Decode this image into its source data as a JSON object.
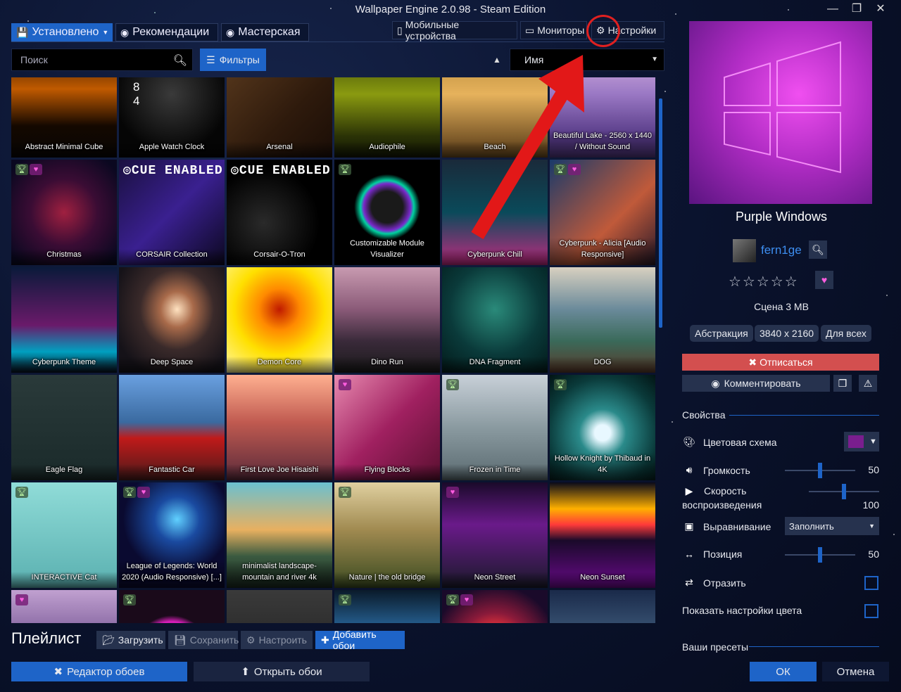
{
  "window": {
    "title": "Wallpaper Engine 2.0.98 - Steam Edition",
    "minimize": "—",
    "restore": "❐",
    "close": "✕"
  },
  "tabs": [
    {
      "label": "Установлено",
      "icon": "download-icon"
    },
    {
      "label": "Рекомендации",
      "icon": "steam-icon"
    },
    {
      "label": "Мастерская",
      "icon": "steam-icon"
    }
  ],
  "top_tabs": [
    {
      "label": "Мобильные устройства",
      "icon": "phone-icon"
    },
    {
      "label": "Мониторы",
      "icon": "monitor-icon"
    },
    {
      "label": "Настройки",
      "icon": "gear-icon"
    }
  ],
  "search": {
    "placeholder": "Поиск"
  },
  "filters": {
    "label": "Фильтры"
  },
  "sort": {
    "selected": "Имя"
  },
  "wallpapers": [
    {
      "title": "Abstract Minimal Cube",
      "bg": "linear-gradient(180deg,#3a1a00 0%,#c05a00 35%,#140800 70%,#080604 100%)",
      "badges": []
    },
    {
      "title": "Apple Watch Clock",
      "bg": "radial-gradient(circle at 50% 40%,#3a3a3a,#050505 70%)",
      "badges": [],
      "clock": true
    },
    {
      "title": "Arsenal",
      "bg": "linear-gradient(135deg,#5a3a1e,#2e1a0c 60%,#1a0d06)",
      "badges": []
    },
    {
      "title": "Audiophile",
      "bg": "linear-gradient(180deg,#3c4a08,#8a9a10 40%,#2a3206 80%,#121603)",
      "badges": []
    },
    {
      "title": "Beach",
      "bg": "linear-gradient(180deg,#b88a3a,#e6b25c 40%,#6a4a20 90%)",
      "badges": []
    },
    {
      "title": "Beautiful Lake - 2560 x 1440 / Without Sound",
      "bg": "linear-gradient(180deg,#d4b0e0,#9a78c4 40%,#563a86 80%)",
      "badges": []
    },
    {
      "title": "Christmas",
      "bg": "radial-gradient(circle at 50% 50%,#a02040 0%,#3a0c34 45%,#0a0820 90%)",
      "badges": [
        "trophy",
        "heart"
      ]
    },
    {
      "title": "CORSAIR Collection",
      "bg": "linear-gradient(135deg,#1a1040,#3a2090 50%,#0c0820)",
      "badges": [],
      "cue": true
    },
    {
      "title": "Corsair-O-Tron",
      "bg": "radial-gradient(circle at 35% 60%,#2a2a2a,#000 60%)",
      "badges": [],
      "cue": true
    },
    {
      "title": "Customizable Module Visualizer",
      "bg": "radial-gradient(circle at 50% 45%,#1a1a1a 20%,#7a2acc 30%,#00d2a0 34%,#000 42%)",
      "badges": [
        "trophy"
      ]
    },
    {
      "title": "Cyberpunk Chill",
      "bg": "linear-gradient(180deg,#1a2a3a,#0a4a5a 50%,#c02a80 100%)",
      "badges": []
    },
    {
      "title": "Cyberpunk - Alicia [Audio Responsive]",
      "bg": "linear-gradient(135deg,#1a3a6a,#c05a3a 60%,#2a1a2a)",
      "badges": [
        "trophy",
        "heart"
      ]
    },
    {
      "title": "Cyberpunk Theme",
      "bg": "linear-gradient(180deg,#0a1a3a,#6a1a6a 55%,#00a0c0 80%,#081020)",
      "badges": []
    },
    {
      "title": "Deep Space",
      "bg": "radial-gradient(ellipse at 55% 40%,#ffe2c0 0%,#a86a4a 20%,#3a2a2a 45%,#151218 80%)",
      "badges": []
    },
    {
      "title": "Demon Core",
      "bg": "radial-gradient(circle at 50% 40%,#c01a00 0%,#ff8a00 25%,#ffe000 55%,#fff6a0 100%)",
      "badges": []
    },
    {
      "title": "Dino Run",
      "bg": "linear-gradient(180deg,#c89ab0 0%,#8a5a78 40%,#3a2a3a 70%,#1a1a1a 100%)",
      "badges": []
    },
    {
      "title": "DNA Fragment",
      "bg": "radial-gradient(circle at 50% 40%,#2a8a7a,#0a3a3a 55%,#021a1a)",
      "badges": []
    },
    {
      "title": "DOG",
      "bg": "linear-gradient(180deg,#d8d0c0 0%,#6a8a9a 40%,#3a6a5a 70%,#5a3a2a 100%)",
      "badges": []
    },
    {
      "title": "Eagle Flag",
      "bg": "linear-gradient(180deg,#2a3a3a,#1a2a2a)",
      "badges": []
    },
    {
      "title": "Fantastic Car",
      "bg": "linear-gradient(180deg,#6aa0e0 0%,#3a6aa0 45%,#c01a1a 60%,#4a1a1a 100%)",
      "badges": []
    },
    {
      "title": "First Love Joe Hisaishi",
      "bg": "linear-gradient(180deg,#ffb090 0%,#c05a50 45%,#5a2a3a 100%)",
      "badges": []
    },
    {
      "title": "Flying Blocks",
      "bg": "linear-gradient(135deg,#e88ab0,#a02060 50%,#5a1030)",
      "badges": [
        "heart"
      ]
    },
    {
      "title": "Frozen in Time",
      "bg": "linear-gradient(180deg,#c8d0d8 0%,#8a9aa0 50%,#5a6a70 100%)",
      "badges": [
        "trophy"
      ]
    },
    {
      "title": "Hollow Knight by Thibaud in 4K",
      "bg": "radial-gradient(circle at 50% 55%,#e8f8ff 10%,#2a8a8a 30%,#0a3a3a 70%,#021414)",
      "badges": [
        "trophy"
      ]
    },
    {
      "title": "INTERACTIVE Cat",
      "bg": "linear-gradient(180deg,#90dcd8,#5ab0b0)",
      "badges": [
        "trophy"
      ]
    },
    {
      "title": "League of Legends: World 2020 (Audio Responsive) [...]",
      "bg": "radial-gradient(circle at 55% 35%,#60d0ff 0%,#1a4aa0 25%,#0a0a30 60%)",
      "badges": [
        "trophy",
        "heart"
      ]
    },
    {
      "title": "minimalist landscape-mountain and river 4k",
      "bg": "linear-gradient(180deg,#6ac0d0 0%,#e8b060 45%,#3a5a40 70%,#1a2a20 100%)",
      "badges": []
    },
    {
      "title": "Nature | the old bridge",
      "bg": "linear-gradient(180deg,#e0d0a0 0%,#a08a50 45%,#3a4a20 100%)",
      "badges": [
        "trophy"
      ]
    },
    {
      "title": "Neon Street",
      "bg": "linear-gradient(180deg,#1a0a2a,#6a1a8a 40%,#1a1a2a 100%)",
      "badges": [
        "heart"
      ]
    },
    {
      "title": "Neon Sunset",
      "bg": "linear-gradient(180deg,#0a0a1a 0%,#ffb000 25%,#ff3a3a 40%,#1a0a2a 55%,#6a0a8a 100%)",
      "badges": []
    },
    {
      "title": "",
      "bg": "linear-gradient(180deg,#c0a0d0,#6a4a8a 60%,#2a1a3a)",
      "badges": [
        "heart"
      ]
    },
    {
      "title": "",
      "bg": "radial-gradient(circle at 50% 60%,#2a0a2a 30%,#e020c0 38%,#1a0a1a 46%)",
      "badges": [
        "trophy"
      ]
    },
    {
      "title": "",
      "bg": "linear-gradient(180deg,#3a3a3a,#1a1a1a)",
      "badges": []
    },
    {
      "title": "",
      "bg": "linear-gradient(180deg,#0a1a2a,#2a6aa0 40%,#c02a4a 80%)",
      "badges": [
        "trophy"
      ]
    },
    {
      "title": "",
      "bg": "radial-gradient(circle at 50% 55%,#ff3a3a 20%,#8a1a3a 45%,#1a0a2a 80%)",
      "badges": [
        "trophy",
        "heart"
      ]
    },
    {
      "title": "",
      "bg": "linear-gradient(180deg,#1a2a4a,#4a6a8a 60%,#1a1a2a)",
      "badges": []
    }
  ],
  "playlist": {
    "title": "Плейлист",
    "load": "Загрузить",
    "save": "Сохранить",
    "configure": "Настроить",
    "add": "Добавить обои"
  },
  "bottom": {
    "editor": "Редактор обоев",
    "open": "Открыть обои",
    "ok": "ОК",
    "cancel": "Отмена"
  },
  "details": {
    "name": "Purple Windows",
    "author": "fern1ge",
    "rating_stars": "☆☆☆☆☆",
    "meta": "Сцена 3 MB",
    "tags": [
      "Абстракция",
      "3840 x 2160",
      "Для всех"
    ],
    "unsubscribe": "Отписаться",
    "comment": "Комментировать"
  },
  "properties": {
    "header": "Свойства",
    "color_scheme": {
      "label": "Цветовая схема",
      "color": "#7a1e8e"
    },
    "volume": {
      "label": "Громкость",
      "value": "50",
      "level": 0.5
    },
    "speed": {
      "label": "Скорость воспроизведения",
      "value": "100",
      "level": 0.5
    },
    "alignment": {
      "label": "Выравнивание",
      "value": "Заполнить"
    },
    "position": {
      "label": "Позиция",
      "value": "50",
      "level": 0.5
    },
    "mirror": {
      "label": "Отразить",
      "checked": false
    },
    "show_color": {
      "label": "Показать настройки цвета",
      "checked": false
    },
    "presets_header": "Ваши пресеты"
  },
  "colors": {
    "accent": "#1e64c8",
    "danger": "#d34f4f",
    "annotation": "#e02020"
  }
}
